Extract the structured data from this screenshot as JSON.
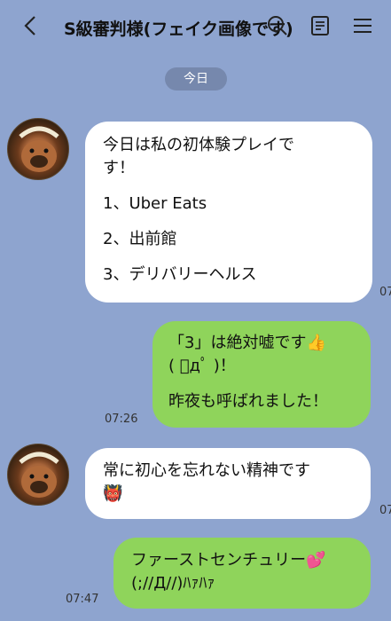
{
  "header": {
    "title": "S級審判様(フェイク画像です)",
    "back_icon": "chevron-left-icon",
    "search_icon": "search-icon",
    "notes_icon": "notes-icon",
    "menu_icon": "hamburger-menu-icon"
  },
  "date_label": "今日",
  "messages": [
    {
      "side": "incoming",
      "lines": [
        "今日は私の初体験プレイで",
        "す！",
        "1、Uber Eats",
        "2、出前館",
        "3、デリバリーヘルス"
      ],
      "time": "07"
    },
    {
      "side": "outgoing",
      "lines": [
        "「3」は絶対嘘です👍",
        "( ﾟдﾟ )！",
        "昨夜も呼ばれました！"
      ],
      "time": "07:26"
    },
    {
      "side": "incoming",
      "lines": [
        "常に初心を忘れない精神です",
        "👹"
      ],
      "time": "07"
    },
    {
      "side": "outgoing",
      "lines": [
        "ファーストセンチュリー💕",
        "(;//Д//)ﾊｧﾊｧ"
      ],
      "time": "07:47"
    }
  ],
  "colors": {
    "background": "#8ea4cf",
    "incoming_bubble": "#ffffff",
    "outgoing_bubble": "#8fd45b",
    "date_pill": "#7688ad"
  }
}
